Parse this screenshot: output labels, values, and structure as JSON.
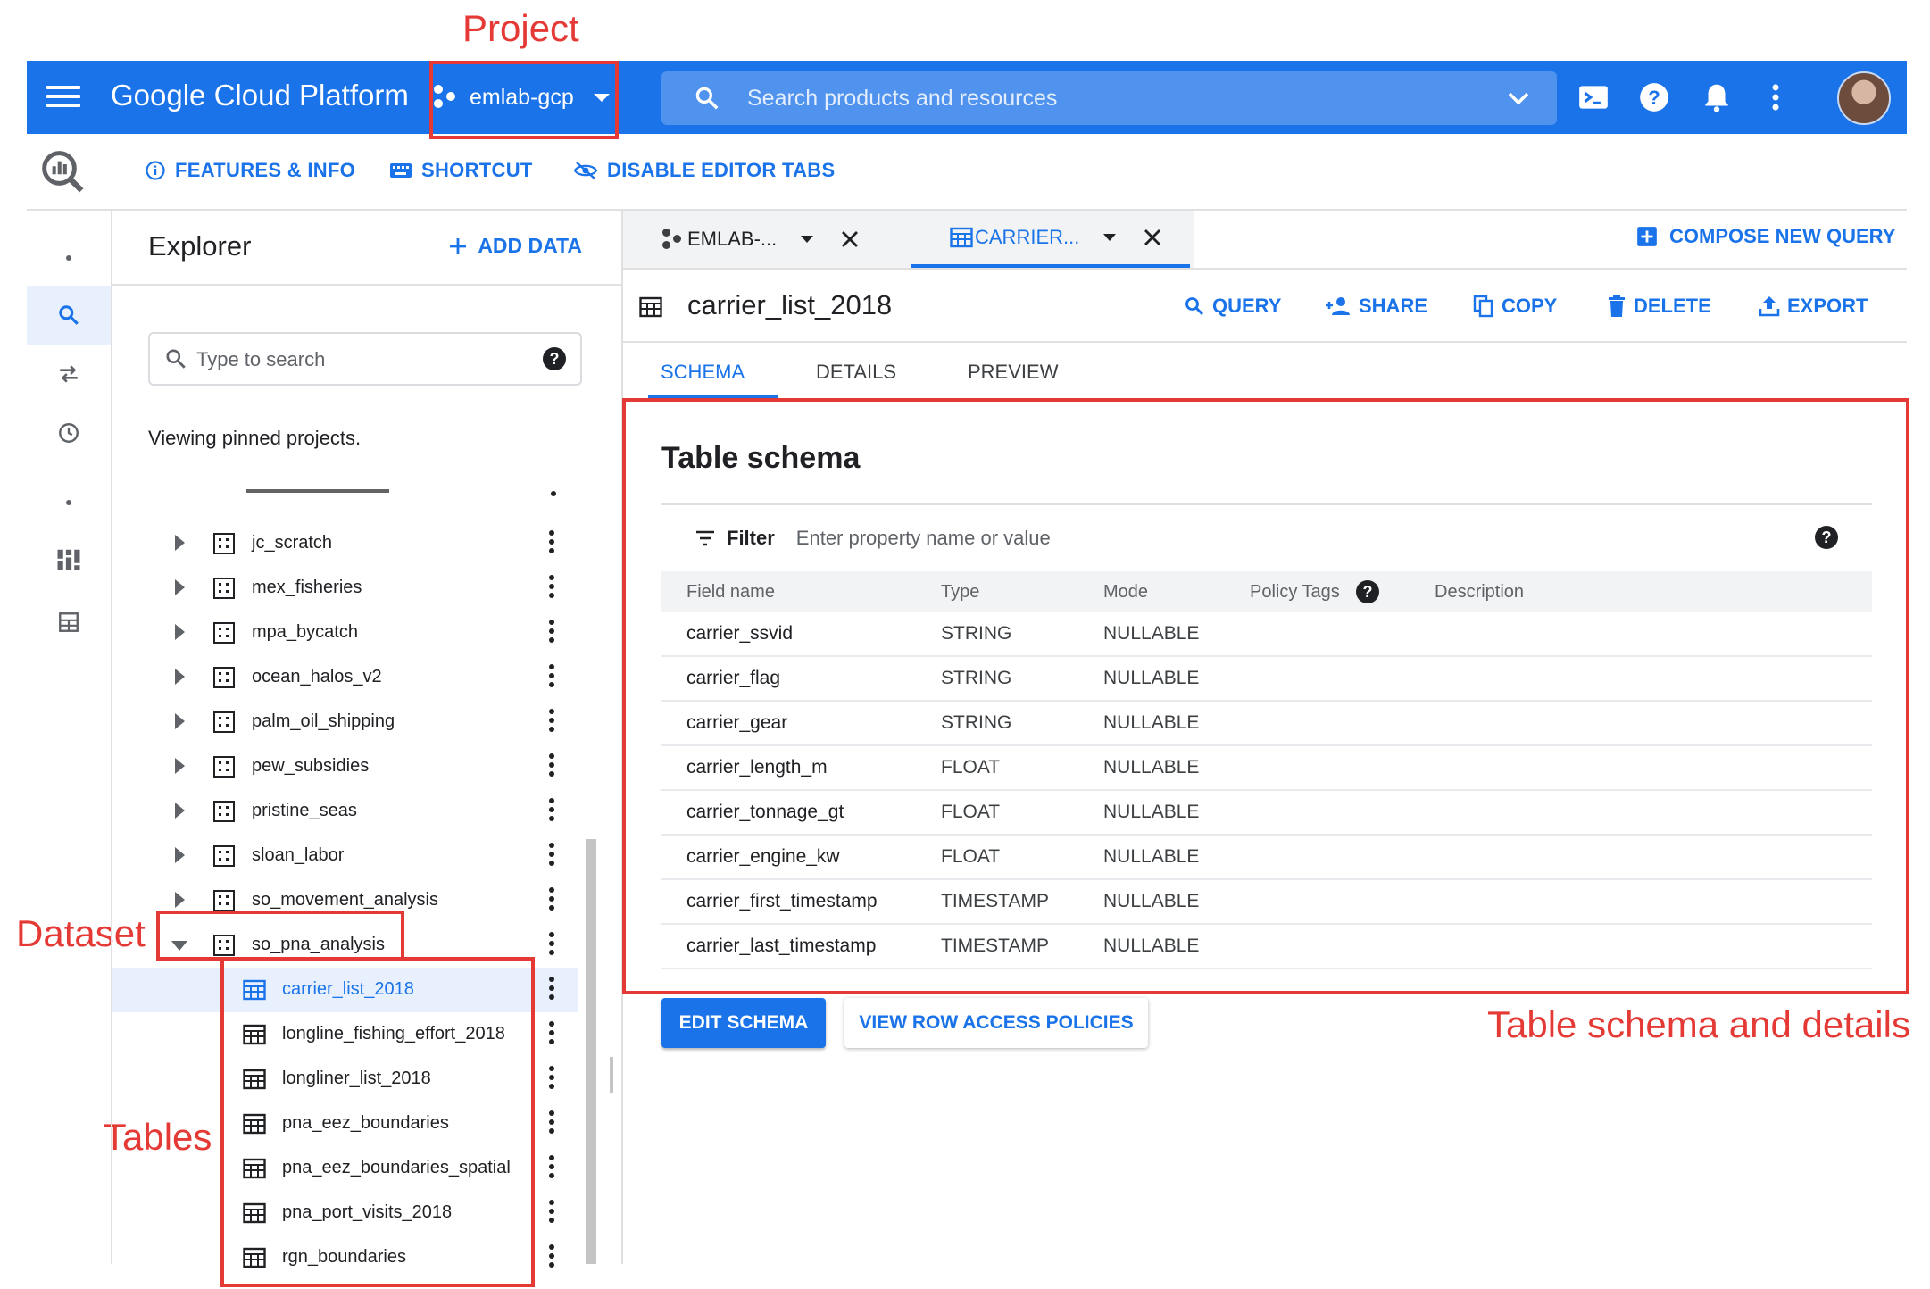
{
  "annotations": {
    "project": "Project",
    "dataset": "Dataset",
    "tables": "Tables",
    "schema": "Table schema and details"
  },
  "topbar": {
    "brand": "Google Cloud Platform",
    "project": "emlab-gcp",
    "search_placeholder": "Search products and resources",
    "color": "#1a73e8"
  },
  "toolbar": {
    "features": "FEATURES & INFO",
    "shortcut": "SHORTCUT",
    "disable_tabs": "DISABLE EDITOR TABS"
  },
  "explorer": {
    "title": "Explorer",
    "add_data": "ADD DATA",
    "search_placeholder": "Type to search",
    "viewing": "Viewing pinned projects.",
    "datasets": [
      {
        "label": "jc_scratch"
      },
      {
        "label": "mex_fisheries"
      },
      {
        "label": "mpa_bycatch"
      },
      {
        "label": "ocean_halos_v2"
      },
      {
        "label": "palm_oil_shipping"
      },
      {
        "label": "pew_subsidies"
      },
      {
        "label": "pristine_seas"
      },
      {
        "label": "sloan_labor"
      },
      {
        "label": "so_movement_analysis"
      },
      {
        "label": "so_pna_analysis"
      }
    ],
    "tables": [
      {
        "label": "carrier_list_2018"
      },
      {
        "label": "longline_fishing_effort_2018"
      },
      {
        "label": "longliner_list_2018"
      },
      {
        "label": "pna_eez_boundaries"
      },
      {
        "label": "pna_eez_boundaries_spatial"
      },
      {
        "label": "pna_port_visits_2018"
      },
      {
        "label": "rgn_boundaries"
      }
    ]
  },
  "query_tabs": [
    {
      "label": "EMLAB-..."
    },
    {
      "label": "CARRIER..."
    }
  ],
  "compose": "COMPOSE NEW QUERY",
  "table": {
    "title": "carrier_list_2018",
    "actions": {
      "query": "QUERY",
      "share": "SHARE",
      "copy": "COPY",
      "delete": "DELETE",
      "export": "EXPORT"
    },
    "subtabs": {
      "schema": "SCHEMA",
      "details": "DETAILS",
      "preview": "PREVIEW"
    }
  },
  "schema": {
    "title": "Table schema",
    "filter_label": "Filter",
    "filter_placeholder": "Enter property name or value",
    "headers": {
      "field": "Field name",
      "type": "Type",
      "mode": "Mode",
      "policy": "Policy Tags",
      "description": "Description"
    },
    "rows": [
      {
        "name": "carrier_ssvid",
        "type": "STRING",
        "mode": "NULLABLE"
      },
      {
        "name": "carrier_flag",
        "type": "STRING",
        "mode": "NULLABLE"
      },
      {
        "name": "carrier_gear",
        "type": "STRING",
        "mode": "NULLABLE"
      },
      {
        "name": "carrier_length_m",
        "type": "FLOAT",
        "mode": "NULLABLE"
      },
      {
        "name": "carrier_tonnage_gt",
        "type": "FLOAT",
        "mode": "NULLABLE"
      },
      {
        "name": "carrier_engine_kw",
        "type": "FLOAT",
        "mode": "NULLABLE"
      },
      {
        "name": "carrier_first_timestamp",
        "type": "TIMESTAMP",
        "mode": "NULLABLE"
      },
      {
        "name": "carrier_last_timestamp",
        "type": "TIMESTAMP",
        "mode": "NULLABLE"
      }
    ],
    "edit_schema": "EDIT SCHEMA",
    "row_access": "VIEW ROW ACCESS POLICIES"
  }
}
